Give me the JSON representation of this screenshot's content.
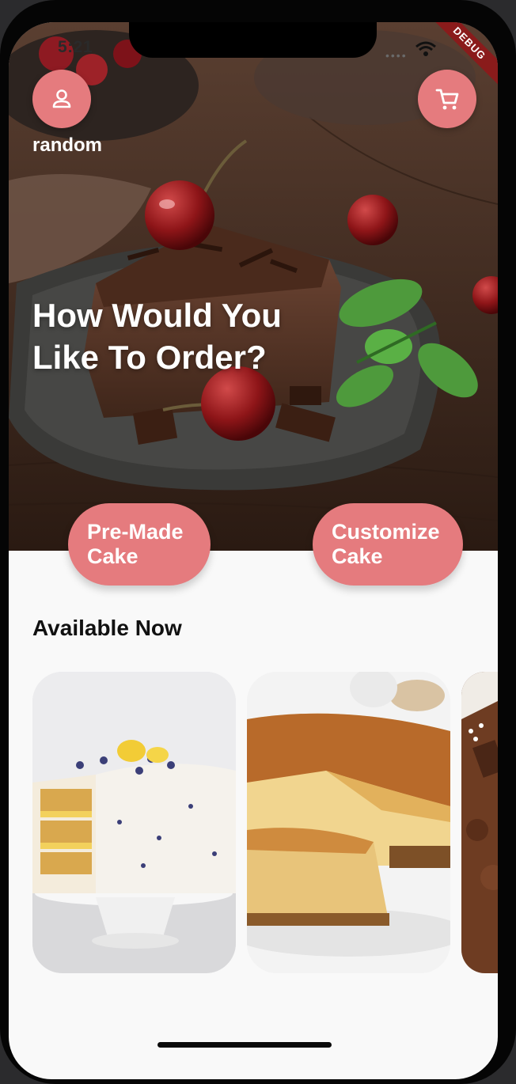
{
  "status_bar": {
    "time": "5:21",
    "debug_label": "DEBUG"
  },
  "header": {
    "username": "random",
    "profile_icon": "person-icon",
    "cart_icon": "cart-icon"
  },
  "hero": {
    "headline_line1": "How Would You",
    "headline_line2": "Like To Order?"
  },
  "order_options": [
    {
      "line1": "Pre-Made",
      "line2": "Cake"
    },
    {
      "line1": "Customize",
      "line2": "Cake"
    }
  ],
  "available": {
    "title": "Available Now"
  },
  "colors": {
    "accent": "#e57b7e",
    "background": "#f9f9f9",
    "debug": "#8a1b1b"
  }
}
